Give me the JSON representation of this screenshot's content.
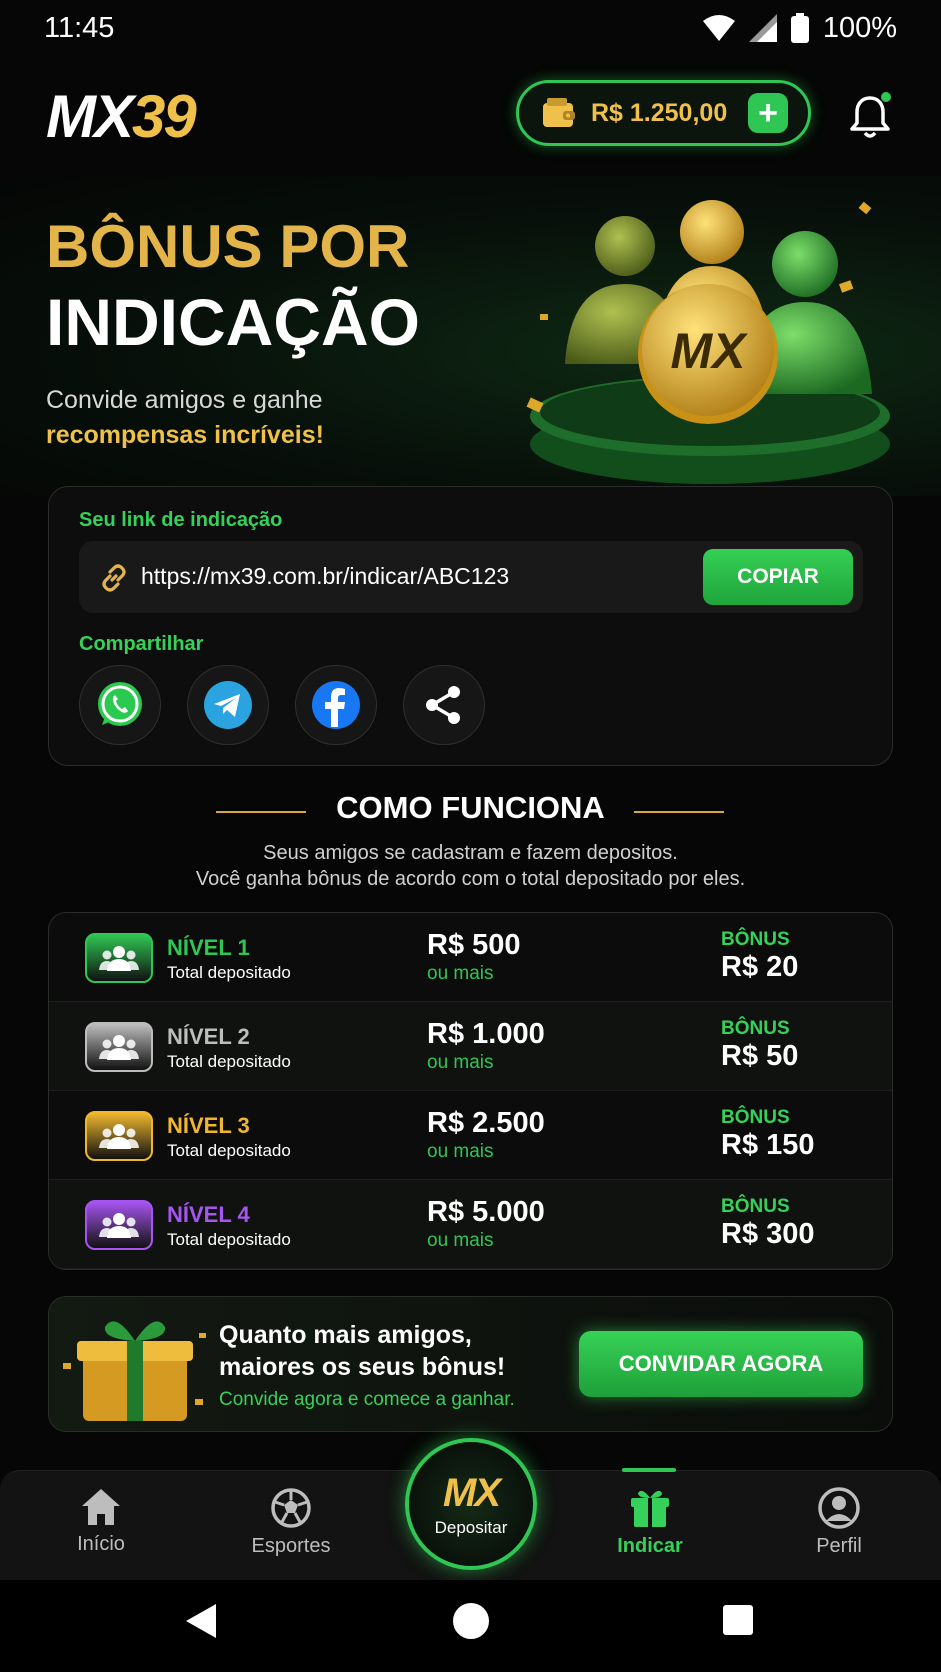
{
  "status_bar": {
    "time": "11:45",
    "battery": "100%"
  },
  "header": {
    "logo_part1": "MX",
    "logo_part2": "39",
    "balance": "R$ 1.250,00",
    "add_label": "+"
  },
  "hero": {
    "title_line1": "BÔNUS POR",
    "title_line2": "INDICAÇÃO",
    "subtitle_line1": "Convide amigos e ganhe",
    "subtitle_line2": "recompensas incríveis!",
    "coin_text": "MX"
  },
  "referral": {
    "link_label": "Seu link de indicação",
    "link": "https://mx39.com.br/indicar/ABC123",
    "copy_label": "COPIAR",
    "share_label": "Compartilhar",
    "share_targets": [
      "whatsapp-icon",
      "telegram-icon",
      "facebook-icon",
      "share-icon"
    ]
  },
  "how": {
    "title": "COMO FUNCIONA",
    "desc_line1": "Seus amigos se cadastram e fazem depositos.",
    "desc_line2": "Você ganha bônus de acordo com o total depositado por eles."
  },
  "levels": [
    {
      "name": "NÍVEL 1",
      "sub": "Total depositado",
      "amount": "R$ 500",
      "more": "ou mais",
      "bonus_label": "BÔNUS",
      "bonus": "R$ 20",
      "color": "#2fc653"
    },
    {
      "name": "NÍVEL 2",
      "sub": "Total depositado",
      "amount": "R$ 1.000",
      "more": "ou mais",
      "bonus_label": "BÔNUS",
      "bonus": "R$ 50",
      "color": "#bdbdbd"
    },
    {
      "name": "NÍVEL 3",
      "sub": "Total depositado",
      "amount": "R$ 2.500",
      "more": "ou mais",
      "bonus_label": "BÔNUS",
      "bonus": "R$ 150",
      "color": "#f0b72e"
    },
    {
      "name": "NÍVEL 4",
      "sub": "Total depositado",
      "amount": "R$ 5.000",
      "more": "ou mais",
      "bonus_label": "BÔNUS",
      "bonus": "R$ 300",
      "color": "#a655f0"
    }
  ],
  "invite": {
    "line1": "Quanto mais amigos,",
    "line2": "maiores os seus bônus!",
    "line3": "Convide agora e comece a ganhar.",
    "button": "CONVIDAR AGORA"
  },
  "nav": {
    "home": "Início",
    "sports": "Esportes",
    "center_logo": "MX",
    "deposit": "Depositar",
    "refer": "Indicar",
    "profile": "Perfil"
  },
  "colors": {
    "accent": "#2fc653",
    "gold": "#f0c14a",
    "background": "#050605"
  }
}
